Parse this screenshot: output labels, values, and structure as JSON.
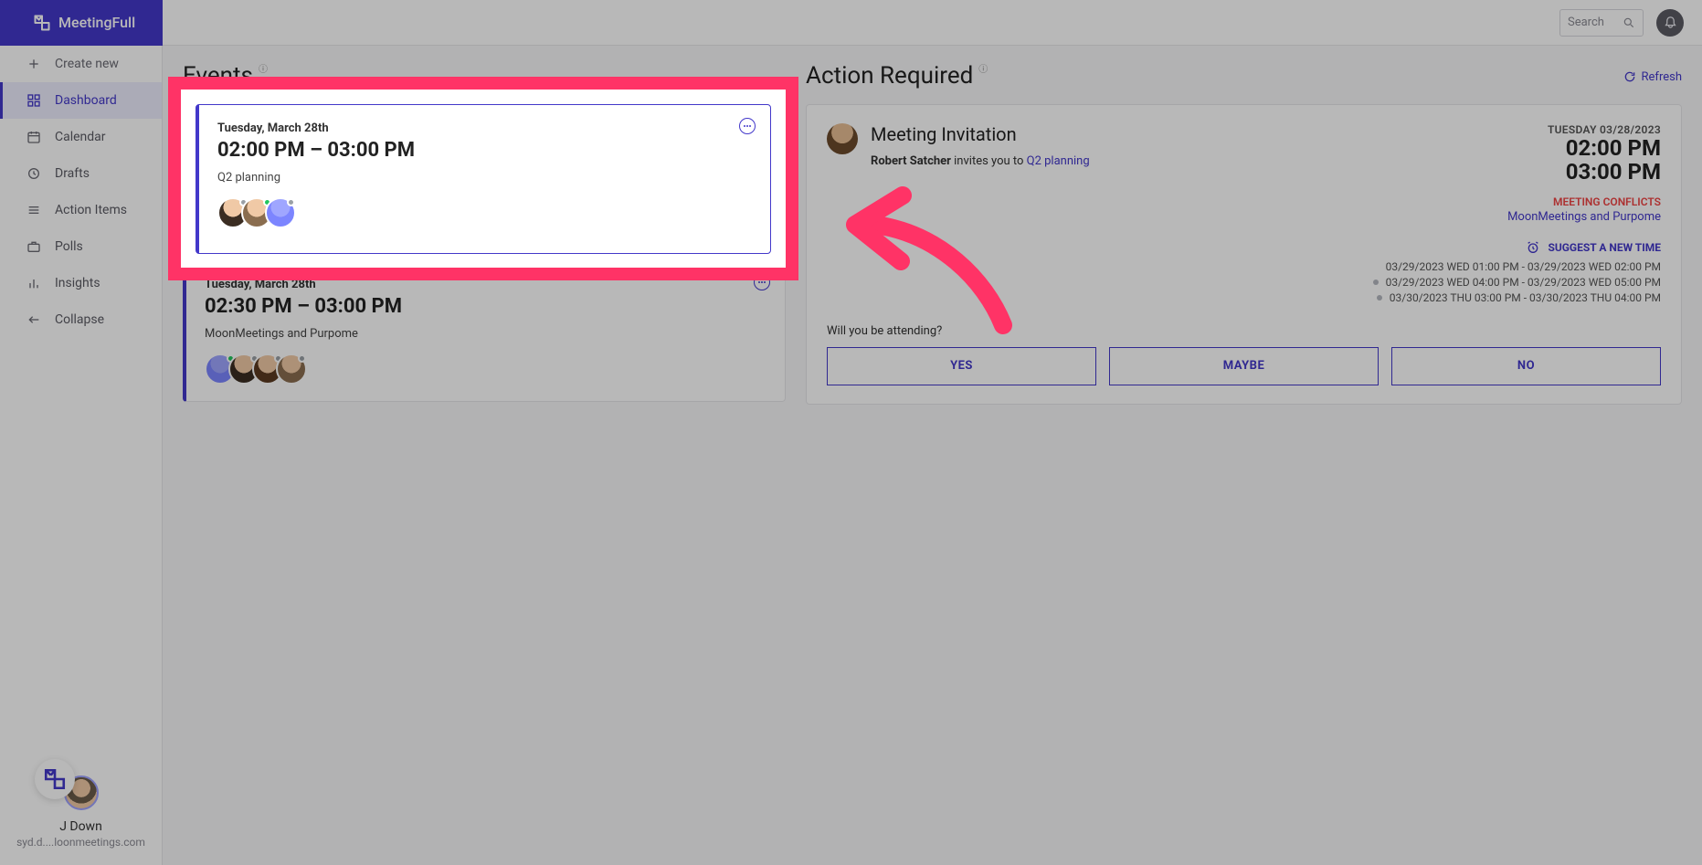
{
  "brand": {
    "name": "MeetingFull"
  },
  "search": {
    "placeholder": "Search"
  },
  "sidebar": {
    "items": [
      {
        "label": "Create new"
      },
      {
        "label": "Dashboard"
      },
      {
        "label": "Calendar"
      },
      {
        "label": "Drafts"
      },
      {
        "label": "Action Items"
      },
      {
        "label": "Polls"
      },
      {
        "label": "Insights"
      },
      {
        "label": "Collapse"
      }
    ],
    "user": {
      "name": "J Down",
      "email": "syd.d....loonmeetings.com"
    }
  },
  "events": {
    "heading": "Events",
    "items": [
      {
        "date": "Tuesday, March 28th",
        "time": "02:00 PM – 03:00 PM",
        "title": "Q2 planning"
      },
      {
        "date": "Tuesday, March 28th",
        "time": "02:30 PM – 03:00 PM",
        "title": "MoonMeetings and Purpome"
      }
    ]
  },
  "action": {
    "heading": "Action Required",
    "refresh": "Refresh",
    "title": "Meeting Invitation",
    "inviter": "Robert Satcher",
    "invite_text": "invites you to",
    "invite_link": "Q2 planning",
    "date": "TUESDAY 03/28/2023",
    "start": "02:00 PM",
    "end": "03:00 PM",
    "conflicts_label": "MEETING CONFLICTS",
    "conflict_link": "MoonMeetings and Purpome",
    "suggest_label": "SUGGEST A NEW TIME",
    "suggestions": [
      "03/29/2023 WED 01:00 PM - 03/29/2023 WED 02:00 PM",
      "03/29/2023 WED 04:00 PM - 03/29/2023 WED 05:00 PM",
      "03/30/2023 THU 03:00 PM - 03/30/2023 THU 04:00 PM"
    ],
    "attend_q": "Will you be attending?",
    "yes": "YES",
    "maybe": "MAYBE",
    "no": "NO"
  }
}
